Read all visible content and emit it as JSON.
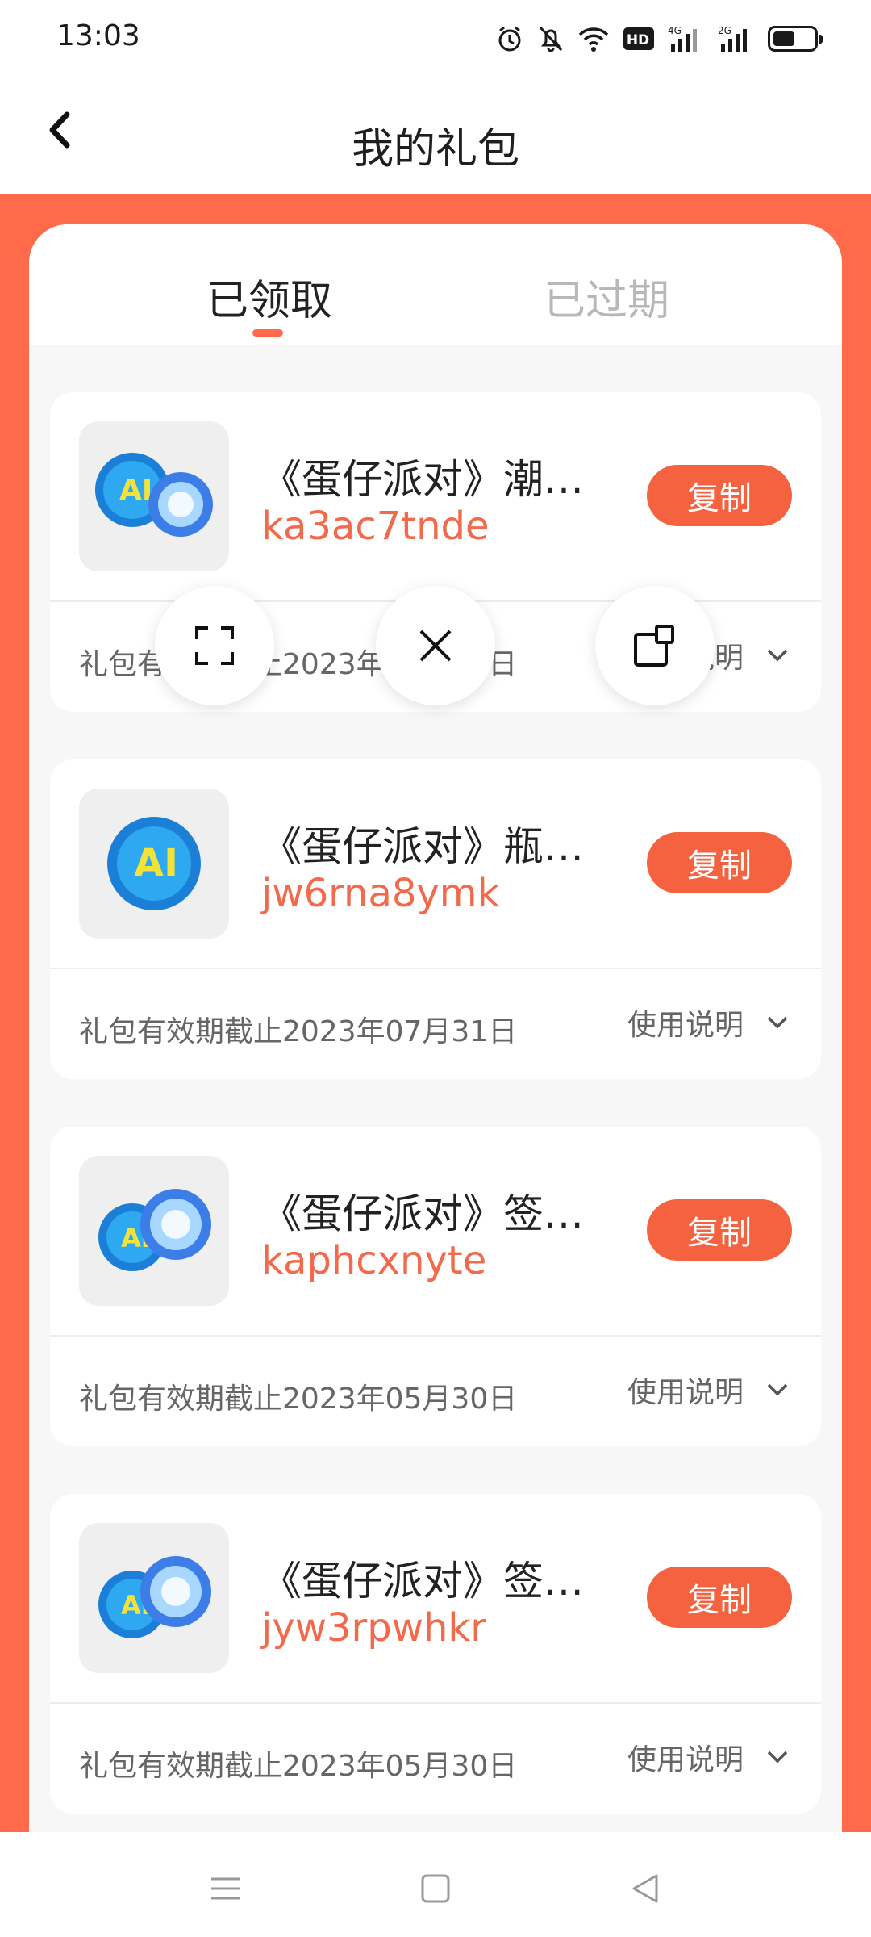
{
  "status_bar": {
    "time": "13:03",
    "icons": [
      "alarm-icon",
      "bell-off-icon",
      "wifi-icon",
      "hd-icon",
      "signal-4g-icon",
      "signal-2g-icon",
      "battery-icon"
    ],
    "hd_label": "HD",
    "net1_label": "4G",
    "net2_label": "2G",
    "battery_level": 0.55
  },
  "header": {
    "title": "我的礼包",
    "back_icon": "chevron-left-icon"
  },
  "tabs": [
    {
      "label": "已领取",
      "active": true
    },
    {
      "label": "已过期",
      "active": false
    }
  ],
  "gifts": [
    {
      "title": "《蛋仔派对》潮…",
      "code": "ka3ac7tnde",
      "copy_label": "复制",
      "expiry": "礼包有效期截止2023年07月31日",
      "usage_label": "使用说明",
      "icon": "game-cap-gem-icon"
    },
    {
      "title": "《蛋仔派对》瓶…",
      "code": "jw6rna8ymk",
      "copy_label": "复制",
      "expiry": "礼包有效期截止2023年07月31日",
      "usage_label": "使用说明",
      "icon": "game-cap-icon"
    },
    {
      "title": "《蛋仔派对》签…",
      "code": "kaphcxnyte",
      "copy_label": "复制",
      "expiry": "礼包有效期截止2023年05月30日",
      "usage_label": "使用说明",
      "icon": "game-cap-gem-icon"
    },
    {
      "title": "《蛋仔派对》签…",
      "code": "jyw3rpwhkr",
      "copy_label": "复制",
      "expiry": "礼包有效期截止2023年05月30日",
      "usage_label": "使用说明",
      "icon": "game-cap-gem-icon"
    }
  ],
  "floating_controls": [
    "fullscreen-icon",
    "close-icon",
    "float-window-icon"
  ],
  "nav_bar": [
    "menu-icon",
    "home-icon",
    "back-icon"
  ],
  "colors": {
    "accent": "#ff6b4a",
    "button": "#f4623f",
    "code_text": "#f26a4b"
  }
}
